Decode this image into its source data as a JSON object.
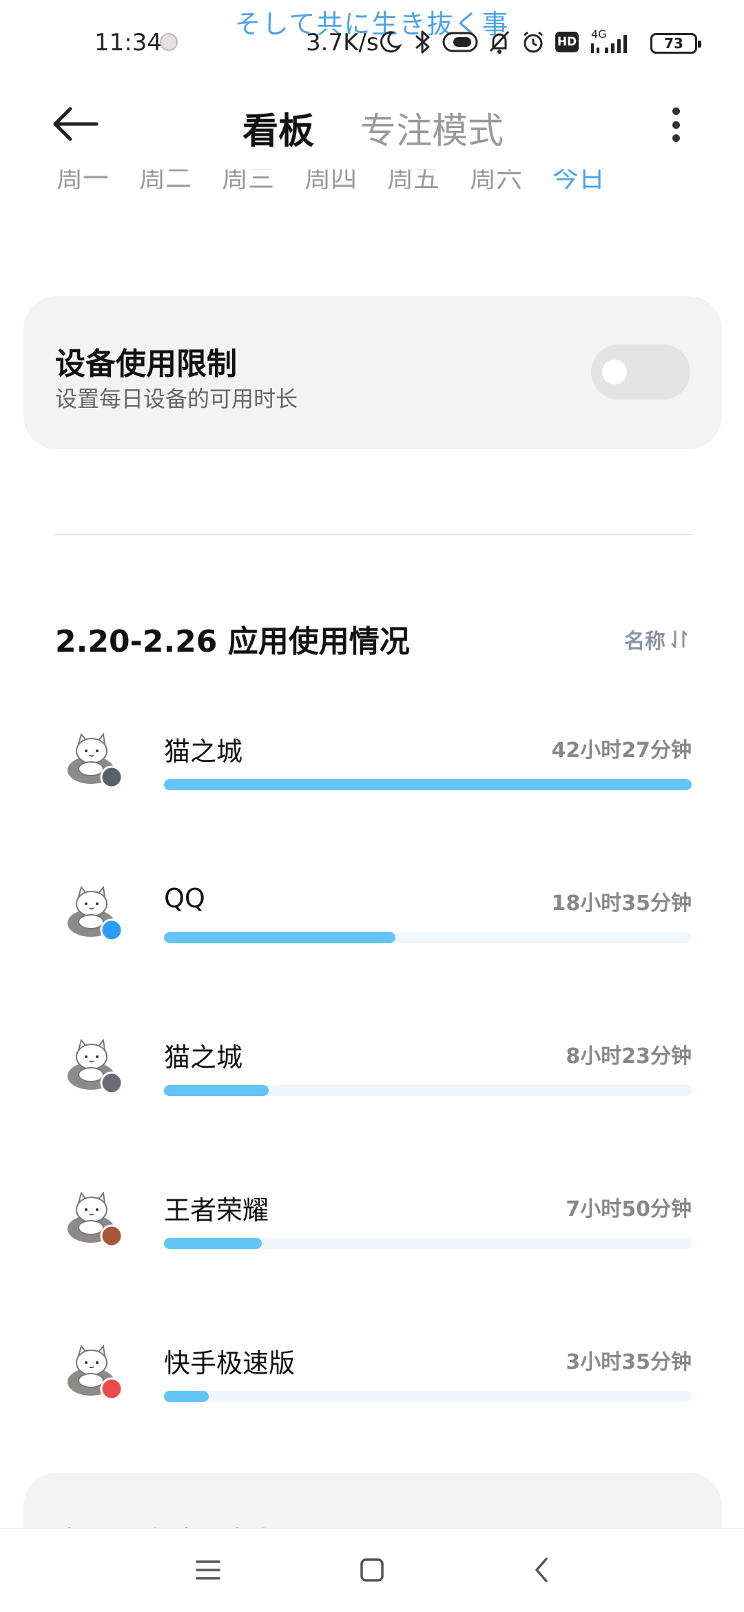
{
  "status_bar": {
    "lyric": "そして共に生き抜く事",
    "time": "11:34",
    "net_speed": "3.7K/s",
    "network_label": "4G",
    "hd_label": "HD",
    "battery": "73",
    "icons": [
      "moon-icon",
      "bluetooth-icon",
      "toggle-pill-icon",
      "bell-off-icon",
      "alarm-icon",
      "hd-icon",
      "signal-icon",
      "battery-icon"
    ]
  },
  "header": {
    "tabs": [
      {
        "label": "看板",
        "active": true
      },
      {
        "label": "专注模式",
        "active": false
      }
    ],
    "icons": [
      "back-arrow-icon",
      "more-vertical-icon"
    ]
  },
  "weekdays": [
    "周一",
    "周二",
    "周三",
    "周四",
    "周五",
    "周六",
    "今日"
  ],
  "device_limit": {
    "title": "设备使用限制",
    "subtitle": "设置每日设备的可用时长",
    "enabled": false
  },
  "usage": {
    "title": "2.20-2.26 应用使用情况",
    "sort_label": "名称",
    "sort_icon": "sort-icon",
    "apps": [
      {
        "name": "猫之城",
        "time": "42小时27分钟",
        "fraction": 1.0,
        "badge_color": "#5a5f6e"
      },
      {
        "name": "QQ",
        "time": "18小时35分钟",
        "fraction": 0.438,
        "badge_color": "#2a9df4"
      },
      {
        "name": "猫之城",
        "time": "8小时23分钟",
        "fraction": 0.198,
        "badge_color": "#6b6b76"
      },
      {
        "name": "王者荣耀",
        "time": "7小时50分钟",
        "fraction": 0.185,
        "badge_color": "#a8553a"
      },
      {
        "name": "快手极速版",
        "time": "3小时35分钟",
        "fraction": 0.085,
        "badge_color": "#ef4a4a"
      }
    ]
  },
  "more_card": {
    "label": "查看更多应用数据"
  },
  "colors": {
    "accent": "#4aa3e8",
    "bar_fill": "#62c5f6",
    "bar_track": "#eef7fd",
    "card_bg": "#f3f3f3"
  },
  "nav_bar": {
    "icons": [
      "menu-icon",
      "home-square-icon",
      "back-chevron-icon"
    ]
  }
}
